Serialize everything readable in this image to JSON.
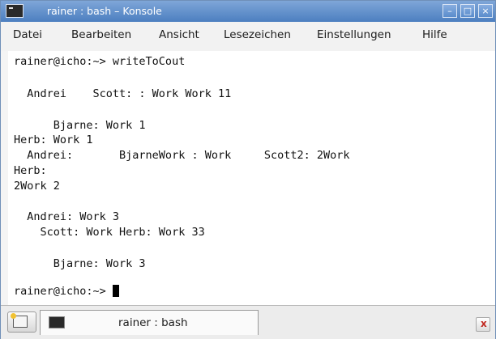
{
  "window": {
    "title": "rainer : bash – Konsole",
    "icon": "terminal-icon",
    "controls": {
      "minimize": "–",
      "maximize": "□",
      "close": "×"
    },
    "accent_color": "#5a8ccc"
  },
  "menu": {
    "items": [
      "Datei",
      "Bearbeiten",
      "Ansicht",
      "Lesezeichen",
      "Einstellungen",
      "Hilfe"
    ]
  },
  "terminal": {
    "lines": [
      "rainer@icho:~> writeToCout",
      "",
      "  Andrei    Scott: : Work Work 11",
      "",
      "      Bjarne: Work 1",
      "Herb: Work 1",
      "  Andrei:       BjarneWork : Work     Scott2: 2Work",
      "Herb:",
      "2Work 2",
      "",
      "  Andrei: Work 3",
      "    Scott: Work Herb: Work 33",
      "",
      "      Bjarne: Work 3",
      "",
      "rainer@icho:~> "
    ]
  },
  "tabbar": {
    "new_tab_icon": "new-tab-icon",
    "tabs": [
      {
        "label": "rainer : bash",
        "icon": "terminal-icon"
      }
    ],
    "close_icon": "close-tab-icon"
  }
}
